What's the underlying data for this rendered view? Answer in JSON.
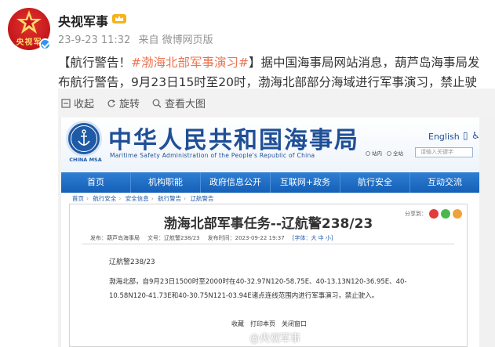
{
  "post": {
    "author": "央视军事",
    "avatar_text": "央视军",
    "date": "23-9-23 11:32",
    "source": "来自 微博网页版",
    "text_prefix": "【航行警告！",
    "hashtag": "#渤海北部军事演习#",
    "text_rest": "】据中国海事局网站消息，葫芦岛海事局发布航行警告，9月23日15时至20时，渤海北部部分海域进行军事演习，禁止驶入。"
  },
  "media_bar": {
    "collapse": "收起",
    "rotate": "旋转",
    "view_large": "查看大图"
  },
  "site": {
    "emblem_label": "CHINA MSA",
    "title": "中华人民共和国海事局",
    "subtitle": "Maritime Safety Administration of the People's Republic of China",
    "lang": "English",
    "search_placeholder": "请输入关键字",
    "nav": [
      "首页",
      "机构职能",
      "政府信息公开",
      "互联网+政务",
      "航行安全",
      "互动交流"
    ],
    "breadcrumb": [
      "首页",
      "航行安全",
      "安全信息",
      "航行警告",
      "辽航警告"
    ],
    "share_label": "分享到：",
    "article": {
      "title": "渤海北部军事任务--辽航警238/23",
      "meta_source": "发布：葫芦岛海事局",
      "meta_id": "文号：辽航警238/23",
      "meta_date": "发布时间：2023-09-22 19:37",
      "meta_font": "[字体：大 中 小]",
      "sub": "辽航警238/23",
      "body": "渤海北部，自9月23日1500时至2000时在40-32.97N120-58.75E、40-13.13N120-36.95E、40-10.58N120-41.73E和40-30.75N121-03.94E诸点连线范围内进行军事演习，禁止驶入。",
      "foot": [
        "收藏",
        "打印本页",
        "关闭窗口"
      ]
    }
  },
  "watermark": "@央视军事",
  "colors": {
    "tag": "#eb7350",
    "msa_blue": "#1f4f96",
    "nav_blue": "#1f6cc4",
    "weibo_red": "#c4161c"
  }
}
